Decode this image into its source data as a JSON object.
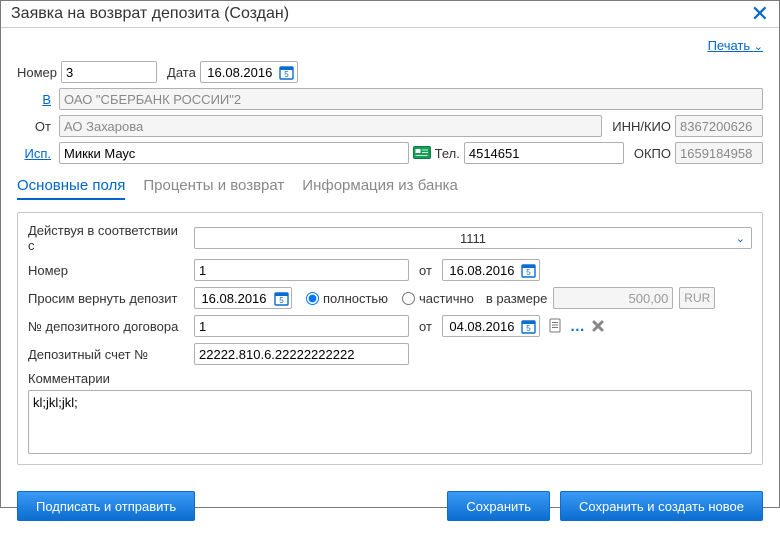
{
  "title": "Заявка на возврат депозита (Создан)",
  "print": {
    "label": "Печать"
  },
  "header": {
    "number_label": "Номер",
    "number": "3",
    "date_label": "Дата",
    "date": "16.08.2016",
    "bank_label": "В",
    "bank": "ОАО \"СБЕРБАНК РОССИИ\"2",
    "from_label": "От",
    "from": "АО Захарова",
    "inn_label": "ИНН/КИО",
    "inn": "8367200626",
    "isp_label": "Исп.",
    "isp": "Микки Маус",
    "tel_label": "Тел.",
    "tel": "4514651",
    "okpo_label": "ОКПО",
    "okpo": "1659184958"
  },
  "tabs": {
    "main": "Основные поля",
    "interest": "Проценты и возврат",
    "bank_info": "Информация из банка"
  },
  "main": {
    "acting_label": "Действуя в соответствии с",
    "acting_value": "1111",
    "number_label": "Номер",
    "number": "1",
    "ot_label": "от",
    "number_date": "16.08.2016",
    "return_label": "Просим вернуть депозит",
    "return_date": "16.08.2016",
    "fully": "полностью",
    "partial": "частично",
    "amount_label": "в размере",
    "amount": "500,00",
    "currency": "RUR",
    "contract_label": "№ депозитного договора",
    "contract_number": "1",
    "contract_date": "04.08.2016",
    "account_label": "Депозитный счет №",
    "account": "22222.810.6.22222222222",
    "comments_label": "Комментарии",
    "comments": "kl;jkl;jkl;"
  },
  "buttons": {
    "sign_send": "Подписать и отправить",
    "save": "Сохранить",
    "save_new": "Сохранить и создать новое"
  }
}
